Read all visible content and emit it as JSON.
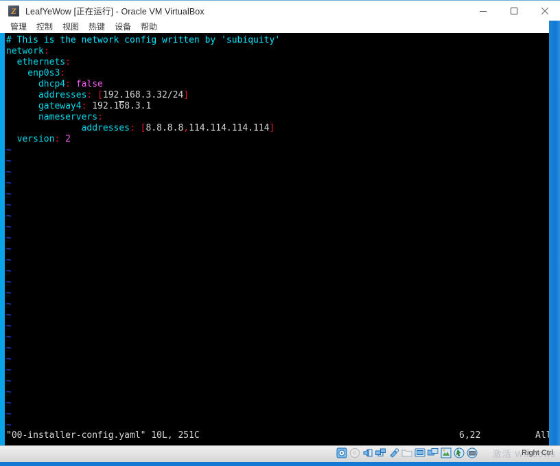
{
  "window": {
    "title": "LeafYeWow [正在运行] - Oracle VM VirtualBox",
    "icon": "virtualbox-icon",
    "controls": {
      "minimize": "minimize-icon",
      "maximize": "maximize-icon",
      "close": "close-icon"
    }
  },
  "menubar": {
    "items": [
      {
        "label": "管理"
      },
      {
        "label": "控制"
      },
      {
        "label": "视图"
      },
      {
        "label": "热键"
      },
      {
        "label": "设备"
      },
      {
        "label": "帮助"
      }
    ]
  },
  "terminal": {
    "editor": "vim",
    "lines": [
      {
        "tokens": [
          {
            "text": "# This is the network config written by 'subiquity'",
            "cls": "c-comment"
          }
        ]
      },
      {
        "tokens": [
          {
            "text": "network",
            "cls": "c-key"
          },
          {
            "text": ":",
            "cls": "c-colon"
          }
        ]
      },
      {
        "tokens": [
          {
            "text": "  ethernets",
            "cls": "c-key"
          },
          {
            "text": ":",
            "cls": "c-colon"
          }
        ]
      },
      {
        "tokens": [
          {
            "text": "    enp0s3",
            "cls": "c-key"
          },
          {
            "text": ":",
            "cls": "c-colon"
          }
        ]
      },
      {
        "tokens": [
          {
            "text": "      dhcp4",
            "cls": "c-key"
          },
          {
            "text": ":",
            "cls": "c-colon"
          },
          {
            "text": " ",
            "cls": "c-plain"
          },
          {
            "text": "false",
            "cls": "c-bool"
          }
        ]
      },
      {
        "tokens": [
          {
            "text": "      addresses",
            "cls": "c-key"
          },
          {
            "text": ":",
            "cls": "c-colon"
          },
          {
            "text": " ",
            "cls": "c-plain"
          },
          {
            "text": "[",
            "cls": "c-brkt"
          },
          {
            "text": "192",
            "cls": "c-plain"
          },
          {
            "text": ".",
            "cls": "c-plain",
            "cursor": true
          },
          {
            "text": "168.3.32/24",
            "cls": "c-plain"
          },
          {
            "text": "]",
            "cls": "c-brkt"
          }
        ]
      },
      {
        "tokens": [
          {
            "text": "      gateway4",
            "cls": "c-key"
          },
          {
            "text": ":",
            "cls": "c-colon"
          },
          {
            "text": " 192.168.3.1",
            "cls": "c-plain"
          }
        ]
      },
      {
        "tokens": [
          {
            "text": "      nameservers",
            "cls": "c-key"
          },
          {
            "text": ":",
            "cls": "c-colon"
          }
        ]
      },
      {
        "tokens": [
          {
            "text": "              addresses",
            "cls": "c-key"
          },
          {
            "text": ":",
            "cls": "c-colon"
          },
          {
            "text": " ",
            "cls": "c-plain"
          },
          {
            "text": "[",
            "cls": "c-brkt"
          },
          {
            "text": "8.8.8.8",
            "cls": "c-plain"
          },
          {
            "text": ",",
            "cls": "c-brkt"
          },
          {
            "text": "114.114.114.114",
            "cls": "c-plain"
          },
          {
            "text": "]",
            "cls": "c-brkt"
          }
        ]
      },
      {
        "tokens": [
          {
            "text": "  version",
            "cls": "c-key"
          },
          {
            "text": ":",
            "cls": "c-colon"
          },
          {
            "text": " ",
            "cls": "c-plain"
          },
          {
            "text": "2",
            "cls": "c-num"
          }
        ]
      }
    ],
    "tilde_count": 26,
    "tilde_char": "~",
    "status": {
      "file": "\"00-installer-config.yaml\" 10L, 251C",
      "position": "6,22",
      "scroll": "All"
    }
  },
  "statusbar": {
    "icons": [
      {
        "name": "hard-disk-icon"
      },
      {
        "name": "optical-disc-icon"
      },
      {
        "name": "audio-icon"
      },
      {
        "name": "network-icon"
      },
      {
        "name": "usb-icon"
      },
      {
        "name": "shared-folder-icon"
      },
      {
        "name": "display-icon"
      },
      {
        "name": "remote-desktop-icon"
      },
      {
        "name": "recording-icon"
      },
      {
        "name": "mouse-integration-icon"
      },
      {
        "name": "keyboard-capture-icon"
      }
    ],
    "host_key_label": "Right Ctrl",
    "watermark": "激活 Windows"
  },
  "colors": {
    "accent_blue": "#0aa2e8",
    "desktop_blue": "#1278d4",
    "terminal_bg": "#000000",
    "comment_cyan": "#00e5ff",
    "key_cyan": "#00d7e8",
    "colon_red": "#e81123",
    "value_magenta": "#ef5bef",
    "plain_text": "#d8d8d8",
    "tilde_blue": "#1b4df7"
  }
}
